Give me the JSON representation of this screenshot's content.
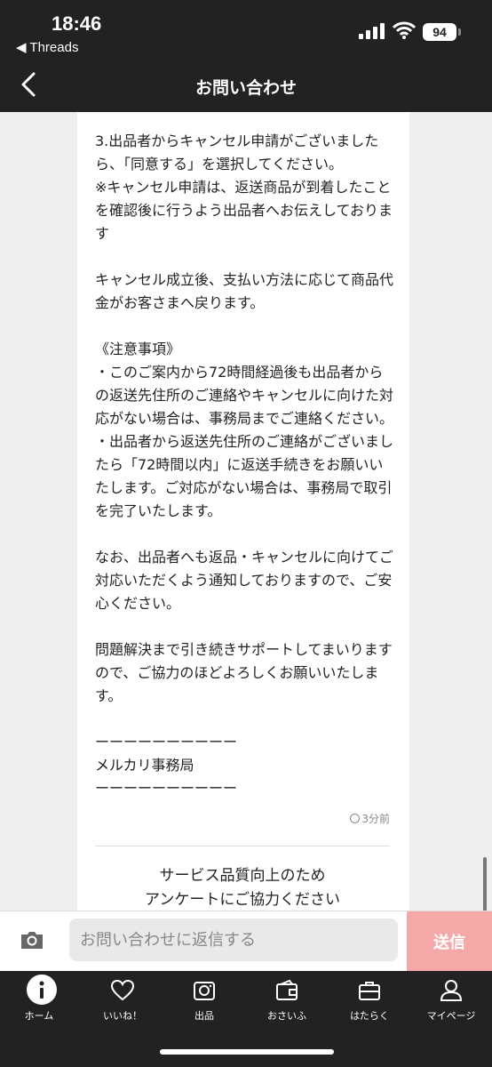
{
  "status": {
    "time": "18:46",
    "back_app": "◀ Threads",
    "battery": "94"
  },
  "nav": {
    "title": "お問い合わせ"
  },
  "message": {
    "body": "3.出品者からキャンセル申請がございましたら、「同意する」を選択してください。\n※キャンセル申請は、返送商品が到着したことを確認後に行うよう出品者へお伝えしております\n\nキャンセル成立後、支払い方法に応じて商品代金がお客さまへ戻ります。\n\n《注意事項》\n・このご案内から72時間経過後も出品者からの返送先住所のご連絡やキャンセルに向けた対応がない場合は、事務局までご連絡ください。\n・出品者から返送先住所のご連絡がございましたら「72時間以内」に返送手続きをお願いいたします。ご対応がない場合は、事務局で取引を完了いたします。\n\nなお、出品者へも返品・キャンセルに向けてご対応いただくよう通知しておりますので、ご安心ください。\n\n問題解決まで引き続きサポートしてまいりますので、ご協力のほどよろしくお願いいたします。\n\nーーーーーーーーーー\nメルカリ事務局\nーーーーーーーーーー",
    "timestamp": "3分前"
  },
  "survey": {
    "line1": "サービス品質向上のため",
    "line2": "アンケートにご協力ください"
  },
  "reply": {
    "placeholder": "お問い合わせに返信する",
    "send_label": "送信"
  },
  "tabs": [
    {
      "label": "ホーム",
      "icon": "home-icon"
    },
    {
      "label": "いいね！",
      "icon": "heart-icon"
    },
    {
      "label": "出品",
      "icon": "camera-icon"
    },
    {
      "label": "おさいふ",
      "icon": "wallet-icon"
    },
    {
      "label": "はたらく",
      "icon": "briefcase-icon"
    },
    {
      "label": "マイページ",
      "icon": "person-icon"
    }
  ],
  "colors": {
    "dark_bar": "#222222",
    "send_button": "#f4a8a8"
  }
}
